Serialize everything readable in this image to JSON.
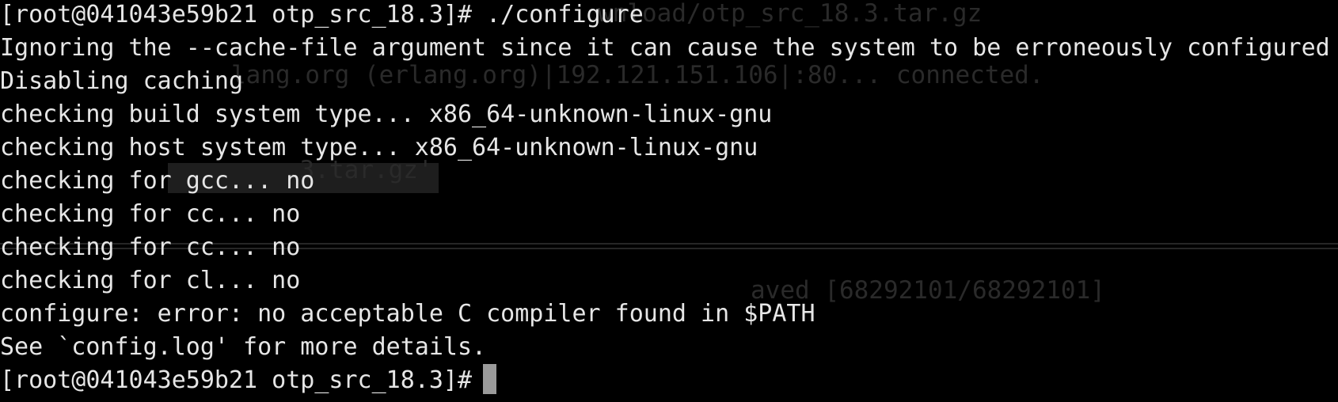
{
  "terminal": {
    "background_color": "#000000",
    "foreground_color": "#e6e6e6",
    "lines": [
      "[root@041043e59b21 otp_src_18.3]# ./configure",
      "Ignoring the --cache-file argument since it can cause the system to be erroneously configured",
      "Disabling caching",
      "checking build system type... x86_64-unknown-linux-gnu",
      "checking host system type... x86_64-unknown-linux-gnu",
      "checking for gcc... no",
      "checking for cc... no",
      "checking for cc... no",
      "checking for cl... no",
      "configure: error: no acceptable C compiler found in $PATH",
      "See `config.log' for more details.",
      "[root@041043e59b21 otp_src_18.3]#"
    ],
    "ghost_text": {
      "color": "#2a2a2a",
      "line_1": "wnload/otp_src_18.3.tar.gz",
      "line_3": "lang.org (erlang.org)|192.121.151.106|:80... connected.",
      "line_6": ".3.tar.gz'",
      "line_10": "aved [68292101/68292101]"
    },
    "cursor": {
      "color": "#9a9a9a",
      "shape": "block"
    }
  }
}
